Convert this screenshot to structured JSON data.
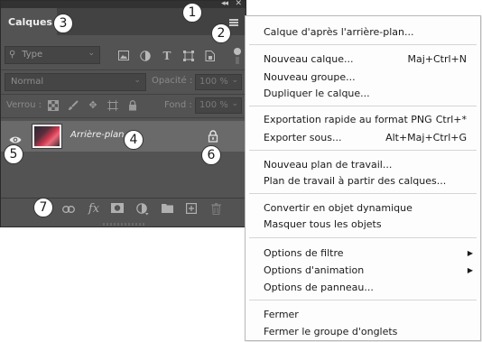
{
  "panel": {
    "tab_label": "Calques",
    "filter": {
      "placeholder": "Type",
      "icons": [
        "image-filter-icon",
        "adjustment-filter-icon",
        "type-filter-icon",
        "shape-filter-icon",
        "smart-object-filter-icon"
      ]
    },
    "blend_mode": "Normal",
    "opacity_label": "Opacité :",
    "opacity_value": "100 %",
    "lock_label": "Verrou :",
    "fill_label": "Fond :",
    "fill_value": "100 %",
    "layer": {
      "name": "Arrière-plan"
    },
    "bottom_icons": [
      "link-icon",
      "fx-icon",
      "mask-icon",
      "adjustment-icon",
      "folder-icon",
      "new-layer-icon",
      "trash-icon"
    ],
    "fx_label": "fx"
  },
  "badges": [
    "1",
    "2",
    "3",
    "4",
    "5",
    "6",
    "7"
  ],
  "menu": {
    "items": [
      {
        "label": "Calque d'après l'arrière-plan...",
        "shortcut": ""
      },
      {
        "label": "Nouveau calque...",
        "shortcut": "Maj+Ctrl+N"
      },
      {
        "label": "Nouveau groupe...",
        "shortcut": ""
      },
      {
        "label": "Dupliquer le calque...",
        "shortcut": ""
      },
      {
        "label": "Exportation rapide au format PNG",
        "shortcut": "Ctrl+*"
      },
      {
        "label": "Exporter sous...",
        "shortcut": "Alt+Maj+Ctrl+G"
      },
      {
        "label": "Nouveau plan de travail...",
        "shortcut": ""
      },
      {
        "label": "Plan de travail à partir des calques...",
        "shortcut": ""
      },
      {
        "label": "Convertir en objet dynamique",
        "shortcut": ""
      },
      {
        "label": "Masquer tous les objets",
        "shortcut": ""
      },
      {
        "label": "Options de filtre",
        "shortcut": ""
      },
      {
        "label": "Options d'animation",
        "shortcut": ""
      },
      {
        "label": "Options de panneau...",
        "shortcut": ""
      },
      {
        "label": "Fermer",
        "shortcut": ""
      },
      {
        "label": "Fermer le groupe d'onglets",
        "shortcut": ""
      }
    ]
  }
}
